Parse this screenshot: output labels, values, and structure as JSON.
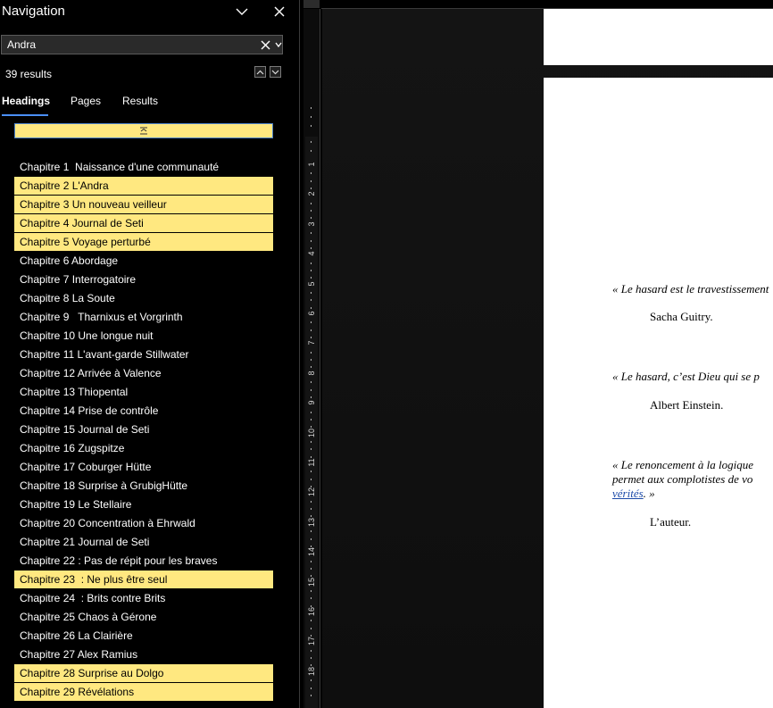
{
  "nav": {
    "title": "Navigation",
    "search": {
      "value": "Andra"
    },
    "results_count": "39 results",
    "tabs": [
      {
        "label": "Headings"
      },
      {
        "label": "Pages"
      },
      {
        "label": "Results"
      }
    ],
    "highlight_color": "#ffe880",
    "headings": [
      {
        "label": "Chapitre 1  Naissance d'une communauté",
        "highlighted": false
      },
      {
        "label": "Chapitre 2 L'Andra",
        "highlighted": true
      },
      {
        "label": "Chapitre 3 Un nouveau veilleur",
        "highlighted": true
      },
      {
        "label": "Chapitre 4 Journal de Seti",
        "highlighted": true
      },
      {
        "label": "Chapitre 5 Voyage perturbé",
        "highlighted": true
      },
      {
        "label": "Chapitre 6 Abordage",
        "highlighted": false
      },
      {
        "label": "Chapitre 7 Interrogatoire",
        "highlighted": false
      },
      {
        "label": "Chapitre 8 La Soute",
        "highlighted": false
      },
      {
        "label": "Chapitre 9   Tharnixus et Vorgrinth",
        "highlighted": false
      },
      {
        "label": "Chapitre 10 Une longue nuit",
        "highlighted": false
      },
      {
        "label": "Chapitre 11 L'avant-garde Stillwater",
        "highlighted": false
      },
      {
        "label": "Chapitre 12 Arrivée à Valence",
        "highlighted": false
      },
      {
        "label": "Chapitre 13 Thiopental",
        "highlighted": false
      },
      {
        "label": "Chapitre 14 Prise de contrôle",
        "highlighted": false
      },
      {
        "label": "Chapitre 15 Journal de Seti",
        "highlighted": false
      },
      {
        "label": "Chapitre 16 Zugspitze",
        "highlighted": false
      },
      {
        "label": "Chapitre 17 Coburger Hütte",
        "highlighted": false
      },
      {
        "label": "Chapitre 18 Surprise à GrubigHütte",
        "highlighted": false
      },
      {
        "label": "Chapitre 19 Le Stellaire",
        "highlighted": false
      },
      {
        "label": "Chapitre 20 Concentration à Ehrwald",
        "highlighted": false
      },
      {
        "label": "Chapitre 21 Journal de Seti",
        "highlighted": false
      },
      {
        "label": "Chapitre 22 : Pas de répit pour les braves",
        "highlighted": false
      },
      {
        "label": "Chapitre 23  : Ne plus être seul",
        "highlighted": true
      },
      {
        "label": "Chapitre 24  : Brits contre Brits",
        "highlighted": false
      },
      {
        "label": "Chapitre 25 Chaos à Gérone",
        "highlighted": false
      },
      {
        "label": "Chapitre 26 La Clairière",
        "highlighted": false
      },
      {
        "label": "Chapitre 27 Alex Ramius",
        "highlighted": false
      },
      {
        "label": "Chapitre 28 Surprise au Dolgo",
        "highlighted": true
      },
      {
        "label": "Chapitre 29 Révélations",
        "highlighted": true
      }
    ]
  },
  "ruler": {
    "numbers": [
      "1",
      "2",
      "3",
      "4",
      "5",
      "6",
      "7",
      "8",
      "9",
      "10",
      "11",
      "12",
      "13",
      "14",
      "15",
      "16",
      "17",
      "18"
    ]
  },
  "document": {
    "quote1": "« Le hasard est le travestissement",
    "author1": "Sacha Guitry.",
    "quote2": "« Le hasard, c’est Dieu qui se p",
    "author2": "Albert Einstein.",
    "quote3_line1": "« Le renoncement à la logique",
    "quote3_line2": "permet aux complotistes de vo",
    "quote3_link": "vérités",
    "quote3_end": ". »",
    "author3": "L’auteur."
  }
}
